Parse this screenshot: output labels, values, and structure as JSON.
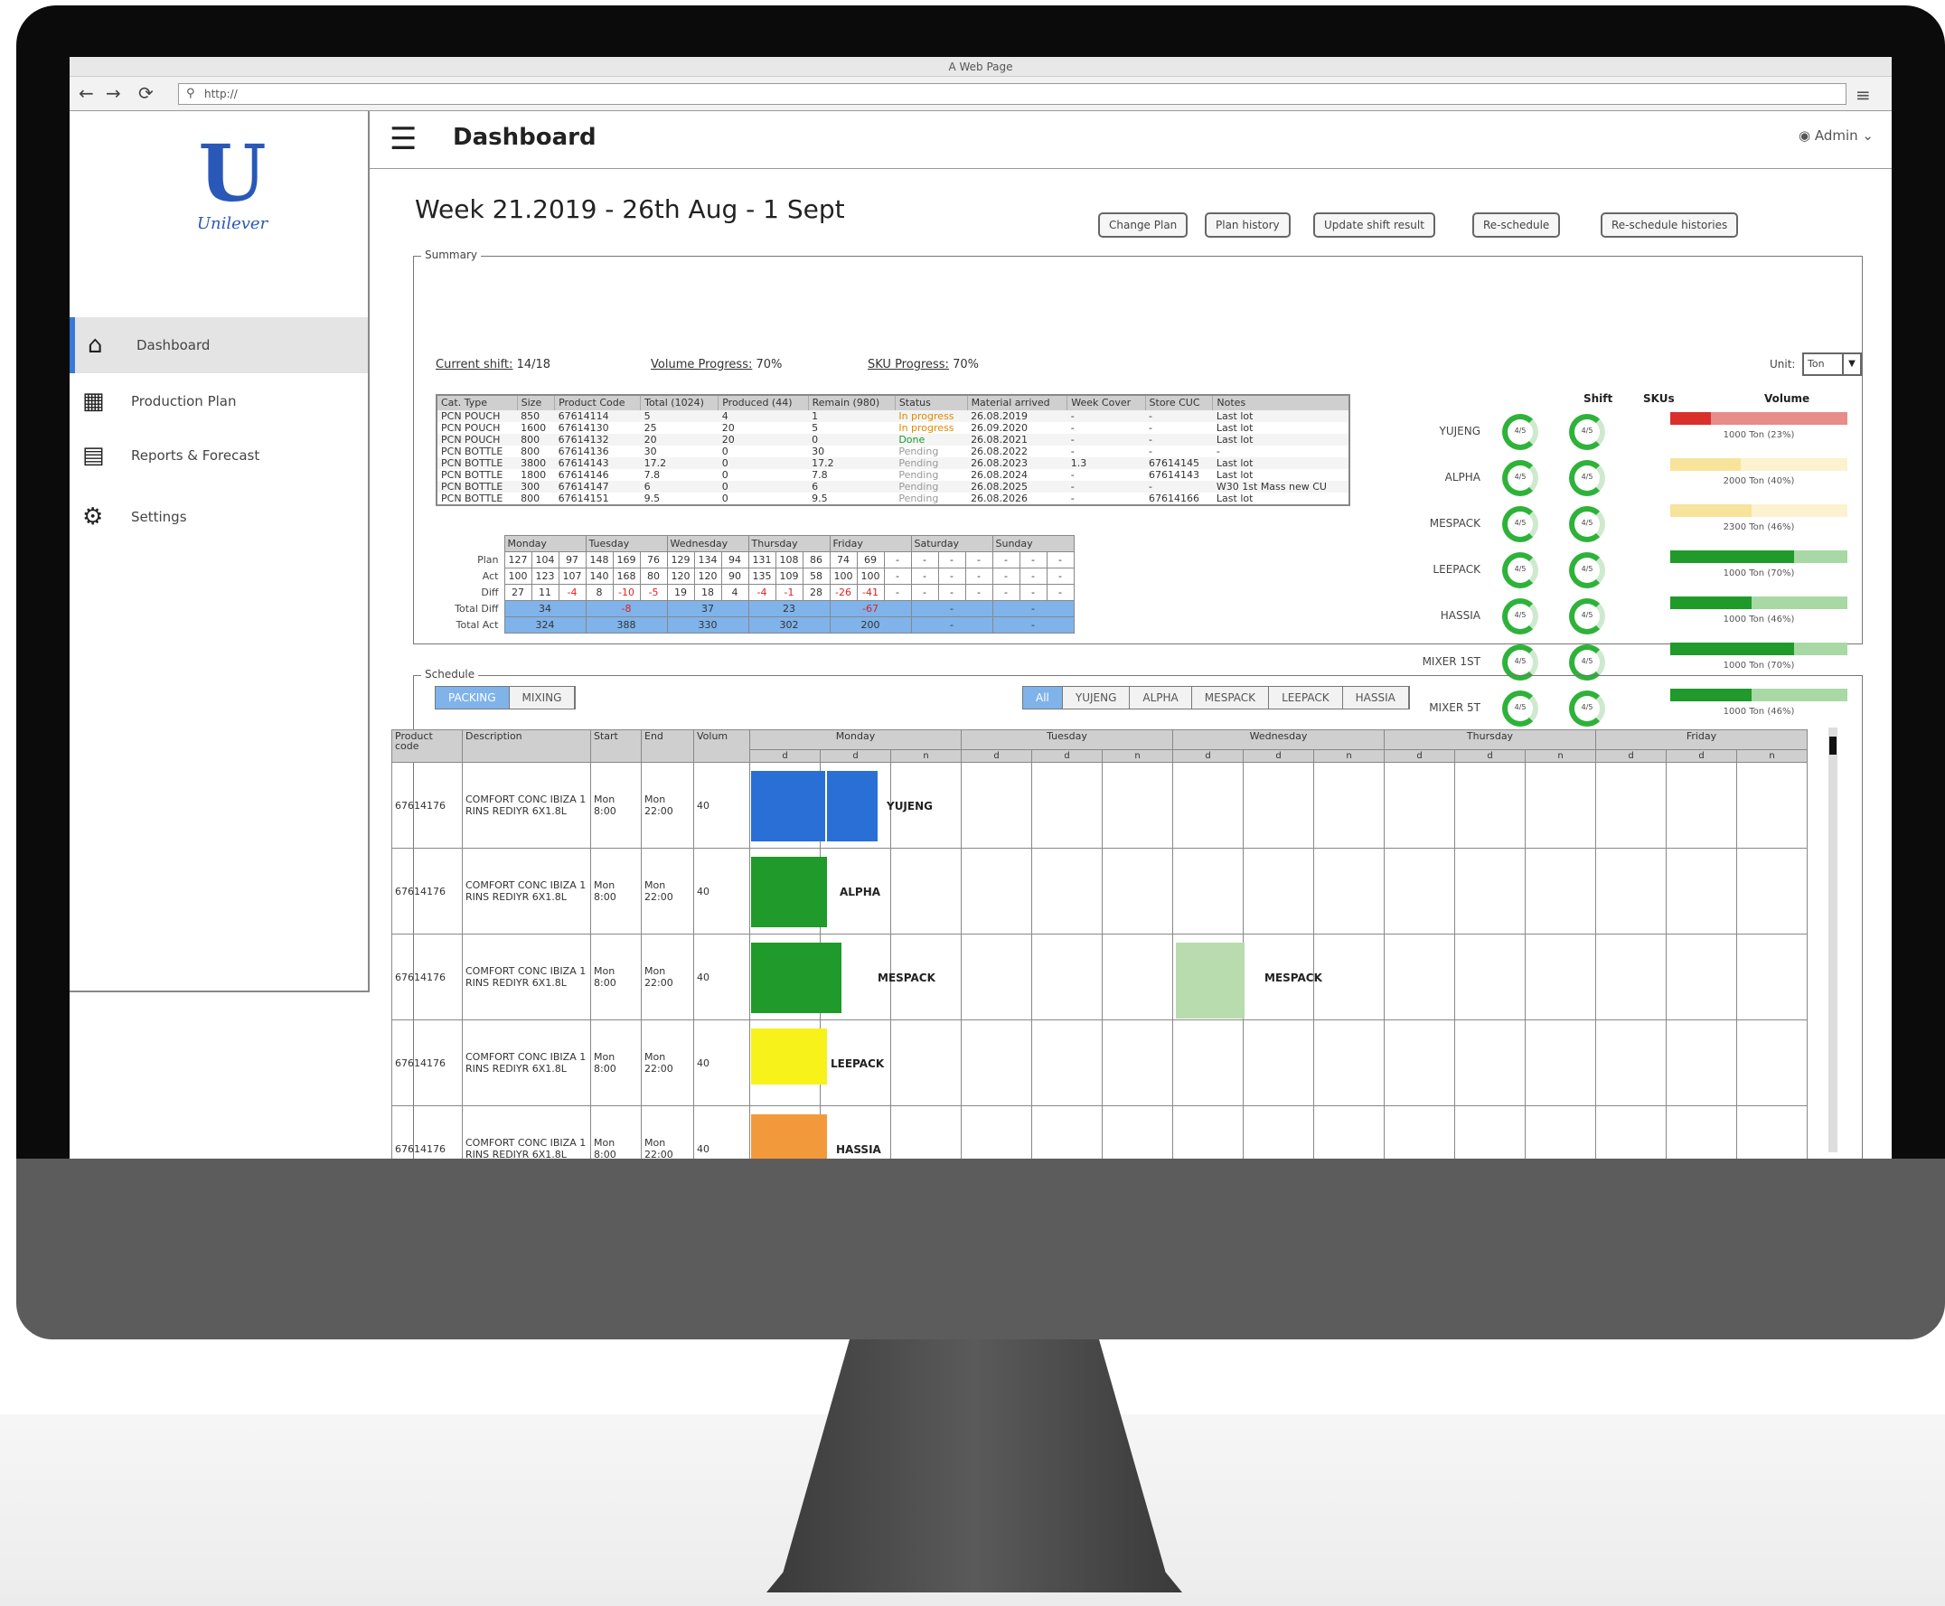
{
  "browser": {
    "title": "A Web Page",
    "url": "http://"
  },
  "header": {
    "title": "Dashboard",
    "user": "Admin"
  },
  "sidebar": {
    "brand": "Unilever",
    "items": [
      {
        "label": "Dashboard",
        "icon": "home-icon"
      },
      {
        "label": "Production Plan",
        "icon": "factory-icon"
      },
      {
        "label": "Reports & Forecast",
        "icon": "map-icon"
      },
      {
        "label": "Settings",
        "icon": "gear-icon"
      }
    ]
  },
  "main": {
    "week_title": "Week 21.2019 - 26th Aug - 1 Sept",
    "actions": [
      "Change Plan",
      "Plan history",
      "Update shift result",
      "Re-schedule",
      "Re-schedule histories"
    ]
  },
  "summary": {
    "legend": "Summary",
    "current_shift_label": "Current shift:",
    "current_shift": "14/18",
    "volume_label": "Volume Progress:",
    "volume": "70%",
    "sku_label": "SKU Progress:",
    "sku": "70%",
    "unit_label": "Unit:",
    "unit": "Ton",
    "columns": [
      "Cat. Type",
      "Size",
      "Product Code",
      "Total (1024)",
      "Produced (44)",
      "Remain (980)",
      "Status",
      "Material arrived",
      "Week Cover",
      "Store CUC",
      "Notes"
    ],
    "rows": [
      [
        "PCN POUCH",
        "850",
        "67614114",
        "5",
        "4",
        "1",
        "In progress",
        "26.08.2019",
        "-",
        "-",
        "Last lot"
      ],
      [
        "PCN POUCH",
        "1600",
        "67614130",
        "25",
        "20",
        "5",
        "In progress",
        "26.09.2020",
        "-",
        "-",
        "Last lot"
      ],
      [
        "PCN POUCH",
        "800",
        "67614132",
        "20",
        "20",
        "0",
        "Done",
        "26.08.2021",
        "-",
        "-",
        "Last lot"
      ],
      [
        "PCN BOTTLE",
        "800",
        "67614136",
        "30",
        "0",
        "30",
        "Pending",
        "26.08.2022",
        "-",
        "-",
        "-"
      ],
      [
        "PCN BOTTLE",
        "3800",
        "67614143",
        "17.2",
        "0",
        "17.2",
        "Pending",
        "26.08.2023",
        "1.3",
        "67614145",
        "Last lot"
      ],
      [
        "PCN BOTTLE",
        "1800",
        "67614146",
        "7.8",
        "0",
        "7.8",
        "Pending",
        "26.08.2024",
        "-",
        "67614143",
        "Last lot"
      ],
      [
        "PCN BOTTLE",
        "300",
        "67614147",
        "6",
        "0",
        "6",
        "Pending",
        "26.08.2025",
        "-",
        "-",
        "W30 1st Mass new CU"
      ],
      [
        "PCN BOTTLE",
        "800",
        "67614151",
        "9.5",
        "0",
        "9.5",
        "Pending",
        "26.08.2026",
        "-",
        "67614166",
        "Last lot"
      ]
    ],
    "days": [
      "Monday",
      "Tuesday",
      "Wednesday",
      "Thursday",
      "Friday",
      "Saturday",
      "Sunday"
    ],
    "weekly": {
      "labels": [
        "Plan",
        "Act",
        "Diff",
        "Total Diff",
        "Total Act"
      ],
      "plan": [
        "127",
        "104",
        "97",
        "148",
        "169",
        "76",
        "129",
        "134",
        "94",
        "131",
        "108",
        "86",
        "74",
        "69",
        "-",
        "-",
        "-",
        "-",
        "-",
        "-",
        "-"
      ],
      "act": [
        "100",
        "123",
        "107",
        "140",
        "168",
        "80",
        "120",
        "120",
        "90",
        "135",
        "109",
        "58",
        "100",
        "100",
        "-",
        "-",
        "-",
        "-",
        "-",
        "-",
        "-"
      ],
      "diff": [
        "27",
        "11",
        "-4",
        "8",
        "-10",
        "-5",
        "19",
        "18",
        "4",
        "-4",
        "-1",
        "28",
        "-26",
        "-41",
        "-",
        "-",
        "-",
        "-",
        "-",
        "-",
        "-"
      ],
      "total_diff": [
        "34",
        "-8",
        "37",
        "23",
        "-67",
        "-",
        "-"
      ],
      "total_act": [
        "324",
        "388",
        "330",
        "302",
        "200",
        "-",
        "-"
      ]
    }
  },
  "facilities": {
    "headers": [
      "Shift",
      "SKUs",
      "Volume"
    ],
    "items": [
      {
        "name": "YUJENG",
        "shift": "4/5",
        "sku": "4/5",
        "pct": 0.23,
        "color": "#d9302c",
        "label": "1000 Ton (23%)"
      },
      {
        "name": "ALPHA",
        "shift": "4/5",
        "sku": "4/5",
        "pct": 0.4,
        "color": "#f7e49a",
        "label": "2000 Ton (40%)"
      },
      {
        "name": "MESPACK",
        "shift": "4/5",
        "sku": "4/5",
        "pct": 0.46,
        "color": "#f7e49a",
        "label": "2300 Ton (46%)"
      },
      {
        "name": "LEEPACK",
        "shift": "4/5",
        "sku": "4/5",
        "pct": 0.7,
        "color": "#1f9a2b",
        "label": "1000 Ton (70%)"
      },
      {
        "name": "HASSIA",
        "shift": "4/5",
        "sku": "4/5",
        "pct": 0.46,
        "color": "#1f9a2b",
        "label": "1000 Ton (46%)"
      },
      {
        "name": "MIXER 1ST",
        "shift": "4/5",
        "sku": "4/5",
        "pct": 0.7,
        "color": "#1f9a2b",
        "label": "1000 Ton (70%)"
      },
      {
        "name": "MIXER 5T",
        "shift": "4/5",
        "sku": "4/5",
        "pct": 0.46,
        "color": "#1f9a2b",
        "label": "1000 Ton (46%)"
      }
    ]
  },
  "schedule": {
    "legend": "Schedule",
    "left_tabs": [
      "PACKING",
      "MIXING"
    ],
    "right_tabs": [
      "All",
      "YUJENG",
      "ALPHA",
      "MESPACK",
      "LEEPACK",
      "HASSIA"
    ],
    "columns": [
      "Product code",
      "Description",
      "Start",
      "End",
      "Volum"
    ],
    "days": [
      "Monday",
      "Tuesday",
      "Wednesday",
      "Thursday",
      "Friday"
    ],
    "shifts": [
      "d",
      "d",
      "n"
    ],
    "rows": [
      {
        "code": "67614176",
        "desc": "COMFORT CONC IBIZA 1 RINS REDIYR 6X1.8L",
        "start": "Mon 8:00",
        "end": "Mon 22:00",
        "vol": "40",
        "line": "YUJENG"
      },
      {
        "code": "67614176",
        "desc": "COMFORT CONC IBIZA 1 RINS REDIYR 6X1.8L",
        "start": "Mon 8:00",
        "end": "Mon 22:00",
        "vol": "40",
        "line": "ALPHA"
      },
      {
        "code": "67614176",
        "desc": "COMFORT CONC IBIZA 1 RINS REDIYR 6X1.8L",
        "start": "Mon 8:00",
        "end": "Mon 22:00",
        "vol": "40",
        "line": "MESPACK",
        "line2": "MESPACK"
      },
      {
        "code": "67614176",
        "desc": "COMFORT CONC IBIZA 1 RINS REDIYR 6X1.8L",
        "start": "Mon 8:00",
        "end": "Mon 22:00",
        "vol": "40",
        "line": "LEEPACK"
      },
      {
        "code": "67614176",
        "desc": "COMFORT CONC IBIZA 1 RINS REDIYR 6X1.8L",
        "start": "Mon 8:00",
        "end": "Mon 22:00",
        "vol": "40",
        "line": "HASSIA"
      }
    ]
  },
  "colors": {
    "blue": "#2a6fd6",
    "green": "#1f9a2b",
    "yellow": "#f7f21a",
    "orange": "#f29a3b",
    "lightgreen": "#b9dcae"
  }
}
